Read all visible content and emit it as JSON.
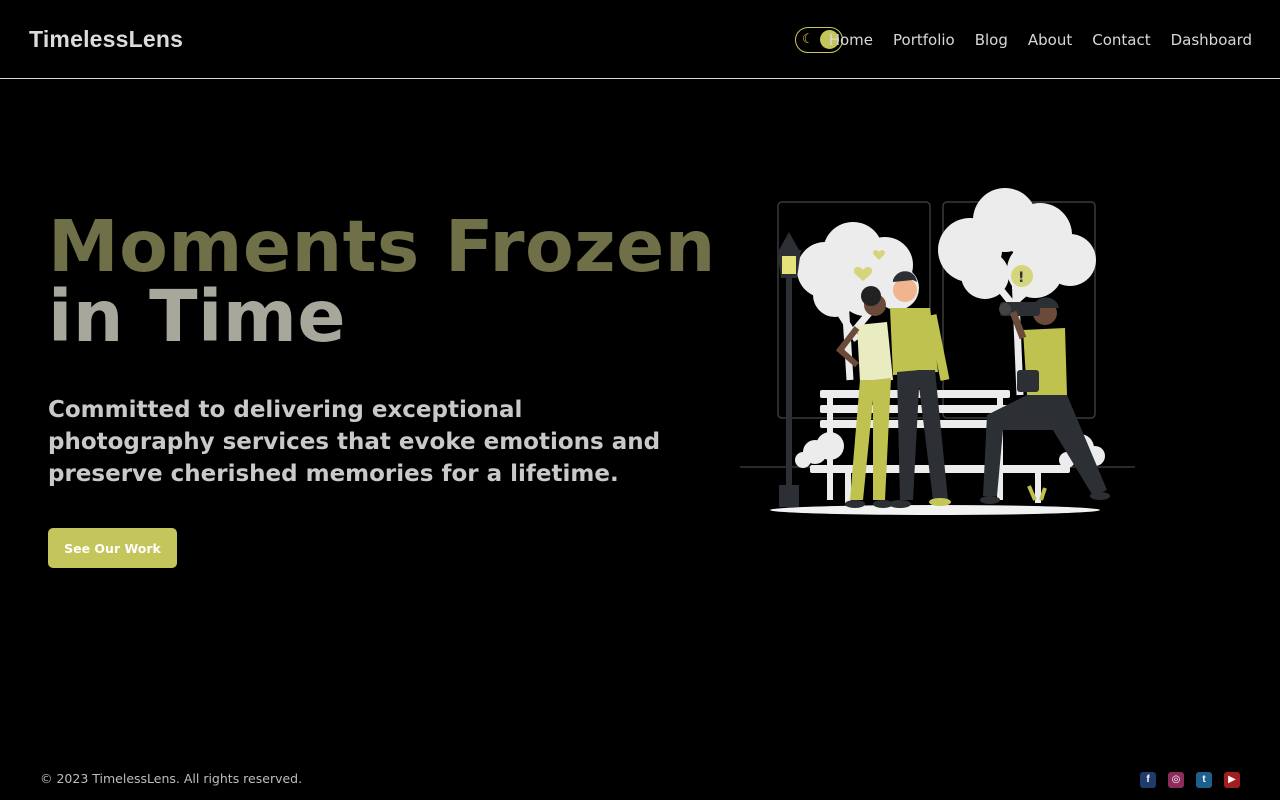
{
  "brand": "TimelessLens",
  "theme_toggle": {
    "icon": "moon-icon",
    "state": "dark"
  },
  "nav": {
    "links": [
      "Home",
      "Portfolio",
      "Blog",
      "About",
      "Contact",
      "Dashboard"
    ]
  },
  "hero": {
    "title_line1": "Moments Frozen",
    "title_line2": "in Time",
    "subtitle": "Committed to delivering exceptional photography services that evoke emotions and preserve cherished memories for a lifetime.",
    "cta_label": "See Our Work"
  },
  "footer": {
    "copyright": "© 2023 TimelessLens. All rights reserved.",
    "social": [
      "facebook-icon",
      "instagram-icon",
      "twitter-icon",
      "youtube-icon"
    ]
  },
  "colors": {
    "accent": "#c4c55a",
    "background": "#000000",
    "title_dark": "#6f6f48",
    "title_light": "#a7a79c"
  }
}
